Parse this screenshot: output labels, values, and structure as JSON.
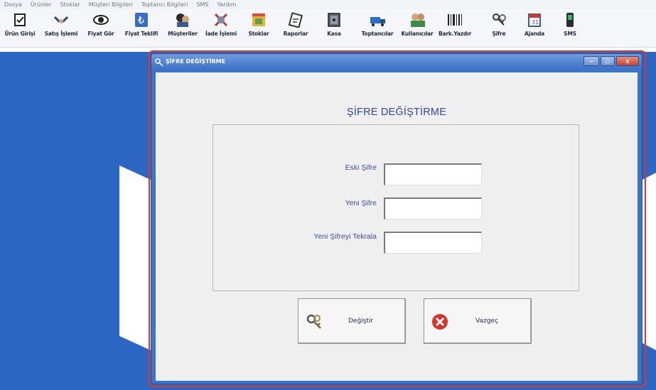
{
  "menu": [
    "Dosya",
    "Ürünler",
    "Stoklar",
    "Müşteri Bilgileri",
    "Toptancı Bilgileri",
    "SMS",
    "Yardım"
  ],
  "toolbar": [
    {
      "label": "Ürün Girişi",
      "icon": "product-entry-icon"
    },
    {
      "label": "Satış İşlemi",
      "icon": "handshake-icon"
    },
    {
      "label": "Fiyat Gör",
      "icon": "eye-icon"
    },
    {
      "label": "Fiyat Teklifi",
      "icon": "lira-icon"
    },
    {
      "label": "Müşteriler",
      "icon": "customers-icon"
    },
    {
      "label": "İade İşlemi",
      "icon": "return-icon"
    },
    {
      "label": "Stoklar",
      "icon": "stock-icon"
    },
    {
      "label": "Raporlar",
      "icon": "reports-icon"
    },
    {
      "label": "Kasa",
      "icon": "safe-icon"
    },
    {
      "label": "Toptancılar",
      "icon": "truck-icon"
    },
    {
      "label": "Kullanıcılar",
      "icon": "users-icon"
    },
    {
      "label": "Bark.Yazdır",
      "icon": "barcode-icon"
    },
    {
      "label": "Şifre",
      "icon": "keys-icon"
    },
    {
      "label": "Ajanda",
      "icon": "calendar-icon"
    },
    {
      "label": "SMS",
      "icon": "phone-icon"
    }
  ],
  "dialog": {
    "title": "ŞİFRE DEĞİŞTİRME",
    "heading": "ŞİFRE DEĞİŞTİRME",
    "fields": [
      {
        "label": "Eski Şifre",
        "value": ""
      },
      {
        "label": "Yeni Şifre",
        "value": ""
      },
      {
        "label": "Yeni Şifreyi Tekrala",
        "value": ""
      }
    ],
    "buttons": {
      "change": "Değiştir",
      "cancel": "Vazgeç"
    }
  },
  "colors": {
    "desktop": "#2b67c2",
    "heading": "#34439b",
    "highlight": "#e2332d"
  }
}
